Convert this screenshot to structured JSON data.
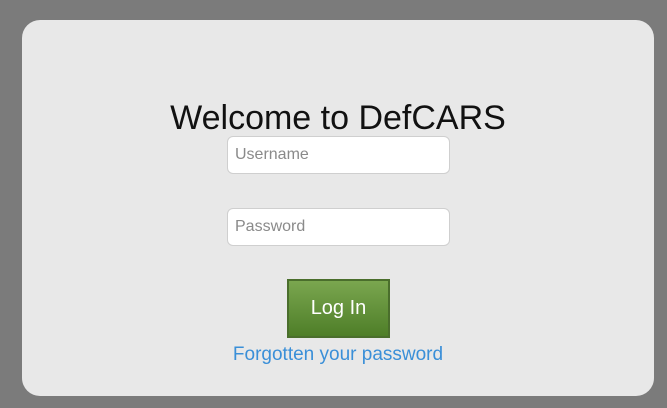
{
  "login": {
    "title": "Welcome to DefCARS",
    "username_placeholder": "Username",
    "password_placeholder": "Password",
    "login_button_label": "Log In",
    "forgot_password_link": "Forgotten your password"
  },
  "colors": {
    "background": "#7b7b7b",
    "panel": "#e8e8e8",
    "button_green": "#5f8f36",
    "link_blue": "#3a8fd8"
  }
}
